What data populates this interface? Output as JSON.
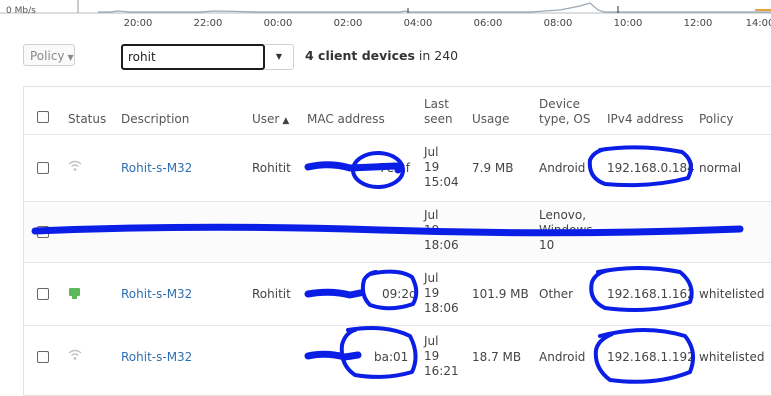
{
  "chart": {
    "y_label": "0 Mb/s",
    "x_ticks": [
      "20:00",
      "22:00",
      "00:00",
      "02:00",
      "04:00",
      "06:00",
      "08:00",
      "10:00",
      "12:00",
      "14:00"
    ]
  },
  "filters": {
    "policy_label": "Policy",
    "search_value": "rohit",
    "count_bold": "4 client devices",
    "count_rest": " in 240"
  },
  "table": {
    "headers": {
      "status": "Status",
      "description": "Description",
      "user": "User",
      "user_sort": "▲",
      "mac": "MAC address",
      "last_seen": [
        "Last",
        "seen"
      ],
      "usage": "Usage",
      "device_type": [
        "Device",
        "type, OS"
      ],
      "ipv4": "IPv4 address",
      "policy": "Policy"
    },
    "rows": [
      {
        "status": "wifi",
        "description": "Rohit-s-M32",
        "user": "Rohitit",
        "mac": "7e:2f",
        "last_seen": [
          "Jul",
          "19",
          "15:04"
        ],
        "usage": "7.9 MB",
        "device_type": [
          "Android"
        ],
        "ipv4": "192.168.0.184",
        "policy": "normal"
      },
      {
        "status": "laptop",
        "description": "",
        "user": "",
        "mac": "",
        "last_seen": [
          "Jul",
          "19",
          "18:06"
        ],
        "usage": "",
        "device_type": [
          "Lenovo,",
          "Windows",
          "10"
        ],
        "ipv4": "",
        "policy": ""
      },
      {
        "status": "lan",
        "description": "Rohit-s-M32",
        "user": "Rohitit",
        "mac": "09:2d",
        "last_seen": [
          "Jul",
          "19",
          "18:06"
        ],
        "usage": "101.9 MB",
        "device_type": [
          "Other"
        ],
        "ipv4": "192.168.1.162",
        "policy": "whitelisted"
      },
      {
        "status": "wifi",
        "description": "Rohit-s-M32",
        "user": "",
        "mac": "ba:01",
        "last_seen": [
          "Jul",
          "19",
          "16:21"
        ],
        "usage": "18.7 MB",
        "device_type": [
          "Android"
        ],
        "ipv4": "192.168.1.192",
        "policy": "whitelisted"
      }
    ]
  },
  "colors": {
    "link": "#2f6fb1",
    "scribble": "#0a1ee6",
    "online_green": "#5cb85c"
  }
}
